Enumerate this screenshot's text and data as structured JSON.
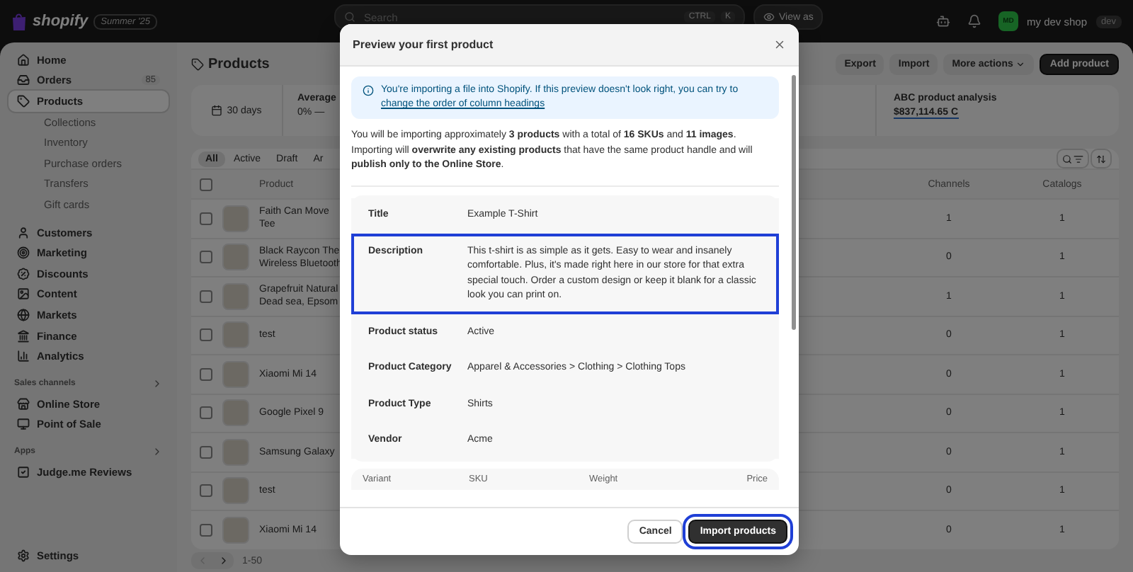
{
  "top_bar": {
    "brand": "shopify",
    "edition_badge": "Summer '25",
    "search": {
      "placeholder": "Search",
      "keys": [
        "CTRL",
        "K"
      ]
    },
    "view_as_button": "View as",
    "store": {
      "avatar_initials": "MD",
      "name": "my dev shop",
      "badge": "dev"
    }
  },
  "sidebar": {
    "groups": [
      {
        "items": [
          {
            "label": "Home",
            "selected": false
          },
          {
            "label": "Orders",
            "count": "85",
            "selected": false
          },
          {
            "label": "Products",
            "selected": true,
            "children": [
              {
                "label": "Collections",
                "selected": false
              },
              {
                "label": "Inventory",
                "selected": false
              },
              {
                "label": "Purchase orders",
                "selected": false
              },
              {
                "label": "Transfers",
                "selected": false
              },
              {
                "label": "Gift cards",
                "selected": false
              }
            ]
          }
        ]
      },
      {
        "items": [
          {
            "label": "Customers",
            "selected": false
          },
          {
            "label": "Marketing",
            "selected": false
          },
          {
            "label": "Discounts",
            "selected": false
          },
          {
            "label": "Content",
            "selected": false
          },
          {
            "label": "Markets",
            "selected": false
          },
          {
            "label": "Finance",
            "selected": false
          },
          {
            "label": "Analytics",
            "selected": false
          }
        ]
      },
      {
        "heading": "Sales channels",
        "items": [
          {
            "label": "Online Store",
            "selected": false
          },
          {
            "label": "Point of Sale",
            "selected": false
          }
        ]
      },
      {
        "heading": "Apps",
        "items": [
          {
            "label": "Judge.me Reviews",
            "selected": false
          }
        ]
      }
    ],
    "footer_item": {
      "label": "Settings",
      "selected": false
    }
  },
  "page": {
    "title": "Products",
    "actions": [
      {
        "label": "Export",
        "kind": "secondary"
      },
      {
        "label": "Import",
        "kind": "secondary"
      },
      {
        "label": "More actions",
        "kind": "menu"
      },
      {
        "label": "Add product",
        "kind": "primary"
      }
    ]
  },
  "metrics": {
    "period": "30 days",
    "average_label": "Average",
    "average_value": "0%",
    "average_trend": "—",
    "analysis_title": "ABC product analysis",
    "analysis_value": "$837,114.65 C"
  },
  "table": {
    "tabs": [
      {
        "label": "All",
        "selected": true
      },
      {
        "label": "Active",
        "selected": false
      },
      {
        "label": "Draft",
        "selected": false
      },
      {
        "label": "Ar",
        "selected": false
      }
    ],
    "columns": [
      "Product",
      "Channels",
      "Catalogs"
    ],
    "header_checked": false,
    "rows": [
      {
        "checked": false,
        "product": [
          "Faith Can Move",
          "Tee"
        ],
        "channels": "1",
        "catalogs": "1"
      },
      {
        "checked": false,
        "product": [
          "Black Raycon The",
          "Wireless Bluetooth"
        ],
        "channels": "0",
        "catalogs": "1"
      },
      {
        "checked": false,
        "product": [
          "Grapefruit Natural",
          "Dead sea, Epsom"
        ],
        "channels": "1",
        "catalogs": "1"
      },
      {
        "checked": false,
        "product": [
          "test"
        ],
        "channels": "0",
        "catalogs": "1"
      },
      {
        "checked": false,
        "product": [
          "Xiaomi Mi 14"
        ],
        "channels": "0",
        "catalogs": "1"
      },
      {
        "checked": false,
        "product": [
          "Google Pixel 9"
        ],
        "channels": "0",
        "catalogs": "1"
      },
      {
        "checked": false,
        "product": [
          "Samsung Galaxy"
        ],
        "channels": "0",
        "catalogs": "1"
      },
      {
        "checked": false,
        "product": [
          "test"
        ],
        "channels": "0",
        "catalogs": "1"
      },
      {
        "checked": false,
        "product": [
          "Xiaomi Mi 14"
        ],
        "channels": "0",
        "catalogs": "1"
      }
    ],
    "pagination": {
      "range": "1-50",
      "previous_disabled": true,
      "next_disabled": false
    }
  },
  "modal": {
    "title": "Preview your first product",
    "banner": {
      "text": "You're importing a file into Shopify. If this preview doesn't look right, you can try to",
      "link": "change the order of column headings"
    },
    "summary": "You will be importing approximately **3 products** with a total of **16 SKUs** and **11 images**. Importing will **overwrite any existing products** that have the same product handle and will **publish only to the Online Store**.",
    "fields": [
      {
        "label": "Title",
        "value": "Example T-Shirt",
        "highlighted": false
      },
      {
        "label": "Description",
        "value": "This t-shirt is as simple as it gets. Easy to wear and insanely comfortable. Plus, it's made right here in our store for that extra special touch. Order a custom design or keep it blank for a classic look you can print on.",
        "highlighted": true
      },
      {
        "label": "Product status",
        "value": "Active",
        "highlighted": false
      },
      {
        "label": "Product Category",
        "value": "Apparel & Accessories > Clothing > Clothing Tops",
        "highlighted": false
      },
      {
        "label": "Product Type",
        "value": "Shirts",
        "highlighted": false
      },
      {
        "label": "Vendor",
        "value": "Acme",
        "highlighted": false
      }
    ],
    "variant_columns": [
      "Variant",
      "SKU",
      "Weight",
      "Price"
    ],
    "buttons": [
      {
        "label": "Cancel",
        "kind": "secondary",
        "highlighted": false
      },
      {
        "label": "Import products",
        "kind": "primary",
        "highlighted": true
      }
    ]
  }
}
